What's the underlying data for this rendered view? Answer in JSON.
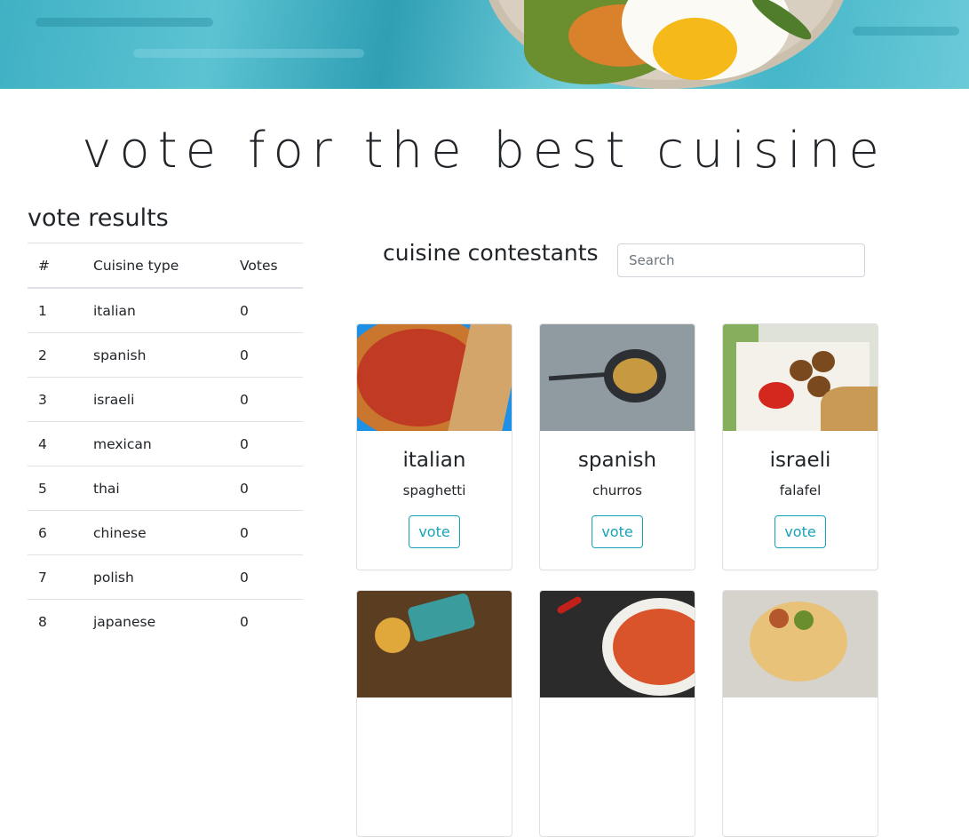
{
  "page": {
    "title": "vote for the best cuisine"
  },
  "results": {
    "title": "vote results",
    "headers": [
      "#",
      "Cuisine type",
      "Votes"
    ],
    "rows": [
      {
        "num": "1",
        "cuisine": "italian",
        "votes": "0"
      },
      {
        "num": "2",
        "cuisine": "spanish",
        "votes": "0"
      },
      {
        "num": "3",
        "cuisine": "israeli",
        "votes": "0"
      },
      {
        "num": "4",
        "cuisine": "mexican",
        "votes": "0"
      },
      {
        "num": "5",
        "cuisine": "thai",
        "votes": "0"
      },
      {
        "num": "6",
        "cuisine": "chinese",
        "votes": "0"
      },
      {
        "num": "7",
        "cuisine": "polish",
        "votes": "0"
      },
      {
        "num": "8",
        "cuisine": "japanese",
        "votes": "0"
      }
    ]
  },
  "contestants": {
    "title": "cuisine contestants",
    "search_placeholder": "Search",
    "vote_label": "vote",
    "cards": [
      {
        "name": "italian",
        "dish": "spaghetti"
      },
      {
        "name": "spanish",
        "dish": "churros"
      },
      {
        "name": "israeli",
        "dish": "falafel"
      }
    ]
  },
  "colors": {
    "accent": "#17a2b8",
    "text": "#212529",
    "border": "#dee2e6"
  }
}
